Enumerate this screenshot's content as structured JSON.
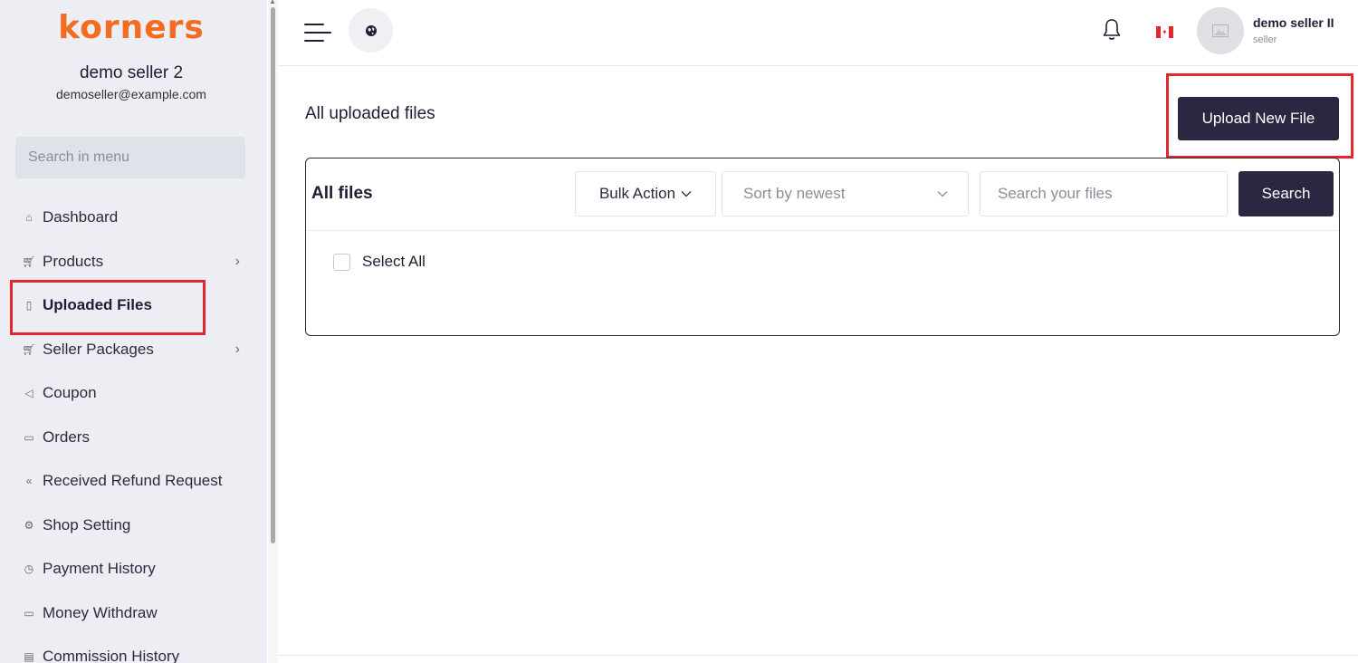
{
  "sidebar": {
    "brand": "korners",
    "shop_name": "demo seller 2",
    "shop_email": "demoseller@example.com",
    "search_placeholder": "Search in menu",
    "items": [
      {
        "label": "Dashboard",
        "icon": "home-icon"
      },
      {
        "label": "Products",
        "icon": "cart-icon",
        "has_submenu": true
      },
      {
        "label": "Uploaded Files",
        "icon": "folder-icon",
        "active": true
      },
      {
        "label": "Seller Packages",
        "icon": "cart-icon",
        "has_submenu": true
      },
      {
        "label": "Coupon",
        "icon": "megaphone-icon"
      },
      {
        "label": "Orders",
        "icon": "money-icon"
      },
      {
        "label": "Received Refund Request",
        "icon": "rewind-icon"
      },
      {
        "label": "Shop Setting",
        "icon": "gear-icon"
      },
      {
        "label": "Payment History",
        "icon": "history-icon"
      },
      {
        "label": "Money Withdraw",
        "icon": "money-icon"
      },
      {
        "label": "Commission History",
        "icon": "document-icon"
      }
    ]
  },
  "topbar": {
    "user_name": "demo seller II",
    "user_role": "seller",
    "language_flag": "canada-flag-icon"
  },
  "main": {
    "page_title": "All uploaded files",
    "upload_button": "Upload New File",
    "card_title": "All files",
    "bulk_action": "Bulk Action",
    "sort_value": "Sort by newest",
    "search_placeholder": "Search your files",
    "search_button": "Search",
    "select_all": "Select All"
  },
  "colors": {
    "brand": "#f36c21",
    "primary_button": "#2b2743",
    "highlight": "#e0282e",
    "sidebar_bg": "#eceef3"
  }
}
